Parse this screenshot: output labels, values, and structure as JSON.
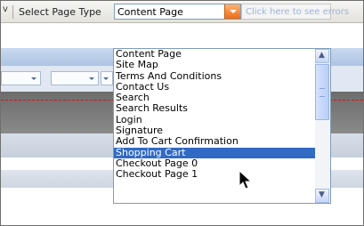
{
  "toolbar": {
    "cut_text": "v",
    "page_type_label": "Select Page Type",
    "selected_value": "Content Page",
    "errors_text": "Click here to see errors"
  },
  "dropdown": {
    "options": [
      "Content Page",
      "Site Map",
      "Terms And Conditions",
      "Contact Us",
      "Search",
      "Search Results",
      "Login",
      "Signature",
      "Add To Cart Confirmation",
      "Shopping Cart",
      "Checkout Page 0",
      "Checkout Page 1"
    ],
    "highlighted_option": "Shopping Cart"
  },
  "icons": {
    "dropdown_arrow": "chevron-down-icon",
    "scroll_up": "chevron-up-icon",
    "scroll_down": "chevron-down-icon",
    "cursor": "mouse-pointer-icon"
  },
  "colors": {
    "selection": "#316ac5",
    "dropdown_button": "#ef6a14",
    "select_border": "#7f9db9"
  }
}
